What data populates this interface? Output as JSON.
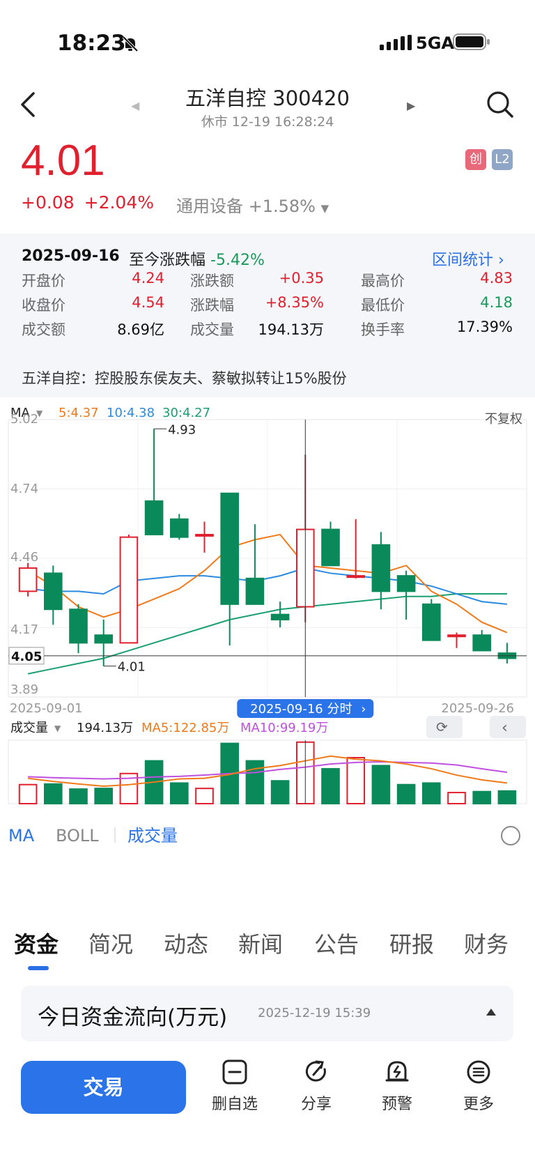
{
  "status": {
    "time": "18:23",
    "network": "5GA"
  },
  "header": {
    "title": "五洋自控 300420",
    "subtitle": "休市 12-19 16:28:24"
  },
  "quote": {
    "price": "4.01",
    "change": "+0.08",
    "change_pct": "+2.04%",
    "sector": "通用设备 +1.58%",
    "badge1": "创",
    "badge2": "L2"
  },
  "interval": {
    "date": "2025-09-16",
    "since_label": "至今涨跌幅",
    "since_value": "-5.42%",
    "stats_link": "区间统计",
    "rows": [
      [
        {
          "label": "开盘价",
          "value": "4.24",
          "color": "#e0202e"
        },
        {
          "label": "涨跌额",
          "value": "+0.35",
          "color": "#e0202e"
        },
        {
          "label": "最高价",
          "value": "4.83",
          "color": "#e0202e"
        }
      ],
      [
        {
          "label": "收盘价",
          "value": "4.54",
          "color": "#e0202e"
        },
        {
          "label": "涨跌幅",
          "value": "+8.35%",
          "color": "#e0202e"
        },
        {
          "label": "最低价",
          "value": "4.18",
          "color": "#1a9a5a"
        }
      ],
      [
        {
          "label": "成交额",
          "value": "8.69亿",
          "color": "#111"
        },
        {
          "label": "成交量",
          "value": "194.13万",
          "color": "#111"
        },
        {
          "label": "换手率",
          "value": "17.39%",
          "color": "#111"
        }
      ]
    ],
    "news": "五洋自控：控股股东侯友夫、蔡敏拟转让15%股份"
  },
  "chart": {
    "ma_label": "MA",
    "ma5": "5:4.37",
    "ma10": "10:4.38",
    "ma30": "30:4.27",
    "adjust": "不复权",
    "y_ticks": [
      "5.02",
      "4.74",
      "4.46",
      "4.17",
      "3.89"
    ],
    "cursor_price": "4.05",
    "high_label": "4.93",
    "low_label": "4.01",
    "x_start": "2025-09-01",
    "x_end": "2025-09-26",
    "cursor_date": "2025-09-16 分时",
    "vol_label": "成交量",
    "vol_value": "194.13万",
    "vol_ma5": "MA5:122.85万",
    "vol_ma10": "MA10:99.19万",
    "ind_ma": "MA",
    "ind_boll": "BOLL",
    "ind_vol": "成交量",
    "colors": {
      "up": "#e0202e",
      "down": "#0a8a5a",
      "ma5": "#f07a1a",
      "ma10": "#2a8ae0",
      "ma30": "#1aa070",
      "vma10": "#c050e0"
    }
  },
  "chart_data": {
    "type": "candlestick",
    "x": [
      "2025-09-01",
      "2025-09-02",
      "2025-09-03",
      "2025-09-04",
      "2025-09-05",
      "2025-09-08",
      "2025-09-09",
      "2025-09-10",
      "2025-09-11",
      "2025-09-12",
      "2025-09-15",
      "2025-09-16",
      "2025-09-17",
      "2025-09-18",
      "2025-09-19",
      "2025-09-22",
      "2025-09-23",
      "2025-09-24",
      "2025-09-25",
      "2025-09-26"
    ],
    "ohlc": [
      [
        4.3,
        4.41,
        4.28,
        4.39
      ],
      [
        4.37,
        4.4,
        4.17,
        4.23
      ],
      [
        4.23,
        4.25,
        4.06,
        4.1
      ],
      [
        4.13,
        4.19,
        4.01,
        4.1
      ],
      [
        4.1,
        4.52,
        4.1,
        4.51
      ],
      [
        4.65,
        4.93,
        4.52,
        4.52
      ],
      [
        4.58,
        4.6,
        4.5,
        4.51
      ],
      [
        4.52,
        4.57,
        4.45,
        4.52
      ],
      [
        4.68,
        4.68,
        4.09,
        4.25
      ],
      [
        4.35,
        4.56,
        4.26,
        4.25
      ],
      [
        4.21,
        4.26,
        4.16,
        4.19
      ],
      [
        4.24,
        4.83,
        4.18,
        4.54
      ],
      [
        4.54,
        4.57,
        4.4,
        4.4
      ],
      [
        4.36,
        4.58,
        4.35,
        4.36
      ],
      [
        4.48,
        4.53,
        4.23,
        4.3
      ],
      [
        4.36,
        4.38,
        4.19,
        4.3
      ],
      [
        4.25,
        4.27,
        4.11,
        4.11
      ],
      [
        4.13,
        4.14,
        4.08,
        4.13
      ],
      [
        4.13,
        4.15,
        4.07,
        4.07
      ],
      [
        4.06,
        4.1,
        4.02,
        4.04
      ]
    ],
    "ma5": [
      4.38,
      4.32,
      4.24,
      4.2,
      4.23,
      4.27,
      4.31,
      4.38,
      4.47,
      4.5,
      4.52,
      4.4,
      4.39,
      4.38,
      4.37,
      4.4,
      4.3,
      4.25,
      4.18,
      4.14
    ],
    "ma10": [
      4.31,
      4.3,
      4.3,
      4.29,
      4.34,
      4.35,
      4.36,
      4.36,
      4.35,
      4.34,
      4.36,
      4.39,
      4.37,
      4.36,
      4.35,
      4.34,
      4.32,
      4.29,
      4.26,
      4.25
    ],
    "ma30": [
      3.98,
      4.0,
      4.02,
      4.04,
      4.07,
      4.1,
      4.13,
      4.16,
      4.19,
      4.21,
      4.23,
      4.24,
      4.25,
      4.26,
      4.27,
      4.28,
      4.28,
      4.29,
      4.29,
      4.29
    ],
    "volume_wan": [
      60,
      62,
      46,
      48,
      95,
      135,
      65,
      48,
      190,
      135,
      72,
      194,
      110,
      145,
      120,
      60,
      65,
      35,
      38,
      40
    ],
    "vol_ma5": [
      80,
      70,
      62,
      55,
      60,
      68,
      78,
      80,
      92,
      110,
      120,
      135,
      150,
      140,
      135,
      125,
      110,
      90,
      75,
      65
    ],
    "vol_ma10": [
      85,
      82,
      80,
      78,
      80,
      84,
      86,
      90,
      95,
      98,
      108,
      115,
      125,
      130,
      132,
      130,
      128,
      122,
      110,
      99
    ],
    "ylim": [
      3.89,
      5.02
    ]
  },
  "tabs": [
    "资金",
    "简况",
    "动态",
    "新闻",
    "公告",
    "研报",
    "财务"
  ],
  "flow": {
    "title": "今日资金流向(万元)",
    "time": "2025-12-19 15:39"
  },
  "bottom": {
    "trade": "交易",
    "buttons": [
      "删自选",
      "分享",
      "预警",
      "更多"
    ]
  }
}
